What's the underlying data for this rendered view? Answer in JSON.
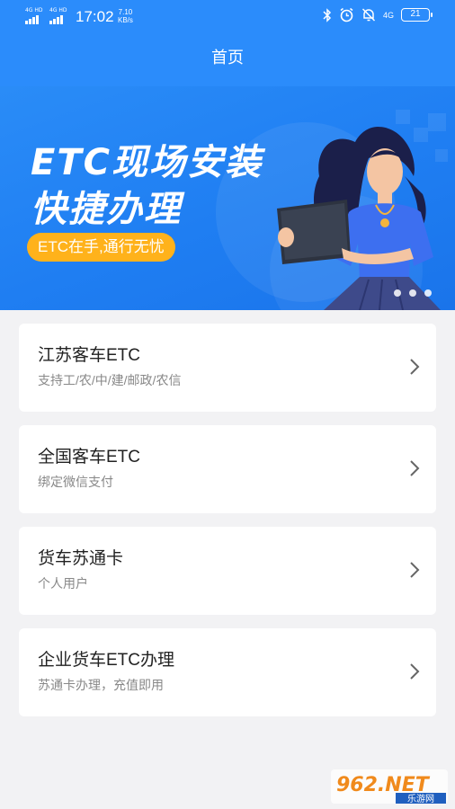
{
  "status_bar": {
    "sim1": "4G HD",
    "sim2": "4G HD",
    "time": "17:02",
    "speed_value": "7.10",
    "speed_unit": "KB/s",
    "battery": "21",
    "network": "4G"
  },
  "header": {
    "title": "首页"
  },
  "banner": {
    "headline_line1": "ETC现场安装",
    "headline_line2": "快捷办理",
    "slogan": "ETC在手,通行无忧",
    "page_count": 3,
    "active_page": 1
  },
  "cards": [
    {
      "title": "江苏客车ETC",
      "subtitle": "支持工/农/中/建/邮政/农信"
    },
    {
      "title": "全国客车ETC",
      "subtitle": "绑定微信支付"
    },
    {
      "title": "货车苏通卡",
      "subtitle": "个人用户"
    },
    {
      "title": "企业货车ETC办理",
      "subtitle": "苏通卡办理，充值即用"
    }
  ],
  "watermark": {
    "brand": "962.NET",
    "site": "乐游网"
  },
  "colors": {
    "primary": "#2b8cfb",
    "accent": "#ffb21b",
    "background": "#f2f2f4"
  }
}
